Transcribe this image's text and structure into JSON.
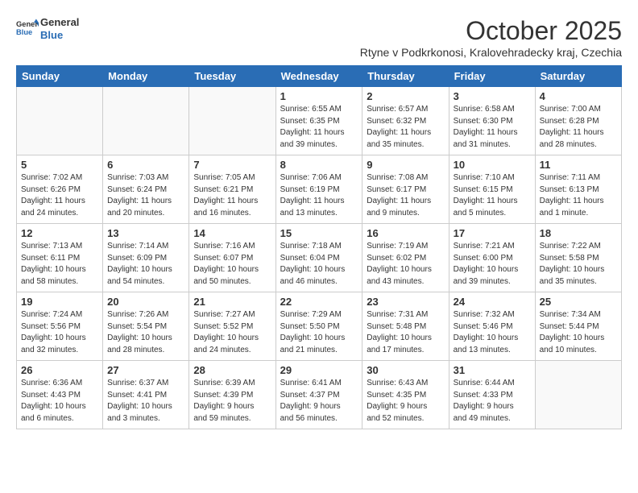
{
  "header": {
    "logo_general": "General",
    "logo_blue": "Blue",
    "month_title": "October 2025",
    "subtitle": "Rtyne v Podkrkonosi, Kralovehradecky kraj, Czechia"
  },
  "weekdays": [
    "Sunday",
    "Monday",
    "Tuesday",
    "Wednesday",
    "Thursday",
    "Friday",
    "Saturday"
  ],
  "weeks": [
    [
      {
        "day": "",
        "info": ""
      },
      {
        "day": "",
        "info": ""
      },
      {
        "day": "",
        "info": ""
      },
      {
        "day": "1",
        "info": "Sunrise: 6:55 AM\nSunset: 6:35 PM\nDaylight: 11 hours\nand 39 minutes."
      },
      {
        "day": "2",
        "info": "Sunrise: 6:57 AM\nSunset: 6:32 PM\nDaylight: 11 hours\nand 35 minutes."
      },
      {
        "day": "3",
        "info": "Sunrise: 6:58 AM\nSunset: 6:30 PM\nDaylight: 11 hours\nand 31 minutes."
      },
      {
        "day": "4",
        "info": "Sunrise: 7:00 AM\nSunset: 6:28 PM\nDaylight: 11 hours\nand 28 minutes."
      }
    ],
    [
      {
        "day": "5",
        "info": "Sunrise: 7:02 AM\nSunset: 6:26 PM\nDaylight: 11 hours\nand 24 minutes."
      },
      {
        "day": "6",
        "info": "Sunrise: 7:03 AM\nSunset: 6:24 PM\nDaylight: 11 hours\nand 20 minutes."
      },
      {
        "day": "7",
        "info": "Sunrise: 7:05 AM\nSunset: 6:21 PM\nDaylight: 11 hours\nand 16 minutes."
      },
      {
        "day": "8",
        "info": "Sunrise: 7:06 AM\nSunset: 6:19 PM\nDaylight: 11 hours\nand 13 minutes."
      },
      {
        "day": "9",
        "info": "Sunrise: 7:08 AM\nSunset: 6:17 PM\nDaylight: 11 hours\nand 9 minutes."
      },
      {
        "day": "10",
        "info": "Sunrise: 7:10 AM\nSunset: 6:15 PM\nDaylight: 11 hours\nand 5 minutes."
      },
      {
        "day": "11",
        "info": "Sunrise: 7:11 AM\nSunset: 6:13 PM\nDaylight: 11 hours\nand 1 minute."
      }
    ],
    [
      {
        "day": "12",
        "info": "Sunrise: 7:13 AM\nSunset: 6:11 PM\nDaylight: 10 hours\nand 58 minutes."
      },
      {
        "day": "13",
        "info": "Sunrise: 7:14 AM\nSunset: 6:09 PM\nDaylight: 10 hours\nand 54 minutes."
      },
      {
        "day": "14",
        "info": "Sunrise: 7:16 AM\nSunset: 6:07 PM\nDaylight: 10 hours\nand 50 minutes."
      },
      {
        "day": "15",
        "info": "Sunrise: 7:18 AM\nSunset: 6:04 PM\nDaylight: 10 hours\nand 46 minutes."
      },
      {
        "day": "16",
        "info": "Sunrise: 7:19 AM\nSunset: 6:02 PM\nDaylight: 10 hours\nand 43 minutes."
      },
      {
        "day": "17",
        "info": "Sunrise: 7:21 AM\nSunset: 6:00 PM\nDaylight: 10 hours\nand 39 minutes."
      },
      {
        "day": "18",
        "info": "Sunrise: 7:22 AM\nSunset: 5:58 PM\nDaylight: 10 hours\nand 35 minutes."
      }
    ],
    [
      {
        "day": "19",
        "info": "Sunrise: 7:24 AM\nSunset: 5:56 PM\nDaylight: 10 hours\nand 32 minutes."
      },
      {
        "day": "20",
        "info": "Sunrise: 7:26 AM\nSunset: 5:54 PM\nDaylight: 10 hours\nand 28 minutes."
      },
      {
        "day": "21",
        "info": "Sunrise: 7:27 AM\nSunset: 5:52 PM\nDaylight: 10 hours\nand 24 minutes."
      },
      {
        "day": "22",
        "info": "Sunrise: 7:29 AM\nSunset: 5:50 PM\nDaylight: 10 hours\nand 21 minutes."
      },
      {
        "day": "23",
        "info": "Sunrise: 7:31 AM\nSunset: 5:48 PM\nDaylight: 10 hours\nand 17 minutes."
      },
      {
        "day": "24",
        "info": "Sunrise: 7:32 AM\nSunset: 5:46 PM\nDaylight: 10 hours\nand 13 minutes."
      },
      {
        "day": "25",
        "info": "Sunrise: 7:34 AM\nSunset: 5:44 PM\nDaylight: 10 hours\nand 10 minutes."
      }
    ],
    [
      {
        "day": "26",
        "info": "Sunrise: 6:36 AM\nSunset: 4:43 PM\nDaylight: 10 hours\nand 6 minutes."
      },
      {
        "day": "27",
        "info": "Sunrise: 6:37 AM\nSunset: 4:41 PM\nDaylight: 10 hours\nand 3 minutes."
      },
      {
        "day": "28",
        "info": "Sunrise: 6:39 AM\nSunset: 4:39 PM\nDaylight: 9 hours\nand 59 minutes."
      },
      {
        "day": "29",
        "info": "Sunrise: 6:41 AM\nSunset: 4:37 PM\nDaylight: 9 hours\nand 56 minutes."
      },
      {
        "day": "30",
        "info": "Sunrise: 6:43 AM\nSunset: 4:35 PM\nDaylight: 9 hours\nand 52 minutes."
      },
      {
        "day": "31",
        "info": "Sunrise: 6:44 AM\nSunset: 4:33 PM\nDaylight: 9 hours\nand 49 minutes."
      },
      {
        "day": "",
        "info": ""
      }
    ]
  ]
}
